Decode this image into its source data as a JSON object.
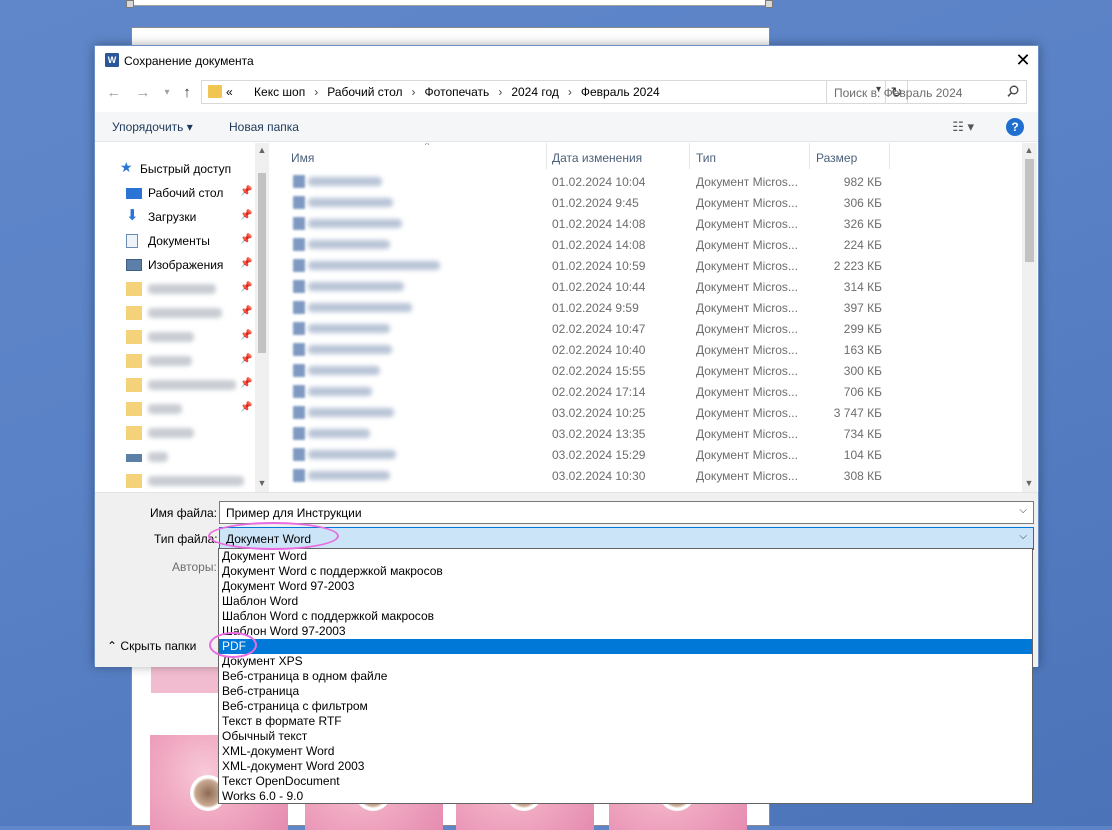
{
  "dialog": {
    "title": "Сохранение документа",
    "close_glyph": "✕",
    "path": [
      "«",
      "Кекс шоп",
      "Рабочий стол",
      "Фотопечать",
      "2024 год",
      "Февраль 2024"
    ],
    "search_placeholder": "Поиск в: Февраль 2024"
  },
  "toolbar": {
    "organize_label": "Упорядочить ▾",
    "new_folder_label": "Новая папка",
    "help_glyph": "?"
  },
  "navpane": {
    "items": [
      {
        "label": "Быстрый доступ",
        "icon": "star-icon"
      },
      {
        "label": "Рабочий стол",
        "icon": "desktop-icon"
      },
      {
        "label": "Загрузки",
        "icon": "download-icon"
      },
      {
        "label": "Документы",
        "icon": "documents-icon"
      },
      {
        "label": "Изображения",
        "icon": "pictures-icon"
      }
    ]
  },
  "columns": {
    "name": "Имя",
    "date": "Дата изменения",
    "type": "Тип",
    "size": "Размер"
  },
  "files": [
    {
      "date": "01.02.2024 10:04",
      "type": "Документ Micros...",
      "size": "982 КБ"
    },
    {
      "date": "01.02.2024 9:45",
      "type": "Документ Micros...",
      "size": "306 КБ"
    },
    {
      "date": "01.02.2024 14:08",
      "type": "Документ Micros...",
      "size": "326 КБ"
    },
    {
      "date": "01.02.2024 14:08",
      "type": "Документ Micros...",
      "size": "224 КБ"
    },
    {
      "date": "01.02.2024 10:59",
      "type": "Документ Micros...",
      "size": "2 223 КБ"
    },
    {
      "date": "01.02.2024 10:44",
      "type": "Документ Micros...",
      "size": "314 КБ"
    },
    {
      "date": "01.02.2024 9:59",
      "type": "Документ Micros...",
      "size": "397 КБ"
    },
    {
      "date": "02.02.2024 10:47",
      "type": "Документ Micros...",
      "size": "299 КБ"
    },
    {
      "date": "02.02.2024 10:40",
      "type": "Документ Micros...",
      "size": "163 КБ"
    },
    {
      "date": "02.02.2024 15:55",
      "type": "Документ Micros...",
      "size": "300 КБ"
    },
    {
      "date": "02.02.2024 17:14",
      "type": "Документ Micros...",
      "size": "706 КБ"
    },
    {
      "date": "03.02.2024 10:25",
      "type": "Документ Micros...",
      "size": "3 747 КБ"
    },
    {
      "date": "03.02.2024 13:35",
      "type": "Документ Micros...",
      "size": "734 КБ"
    },
    {
      "date": "03.02.2024 15:29",
      "type": "Документ Micros...",
      "size": "104 КБ"
    },
    {
      "date": "03.02.2024 10:30",
      "type": "Документ Micros...",
      "size": "308 КБ"
    }
  ],
  "form": {
    "filename_label": "Имя файла:",
    "filename_value": "Пример для Инструкции",
    "filetype_label": "Тип файла:",
    "filetype_value": "Документ Word",
    "authors_label": "Авторы:",
    "hide_folders_label": "Скрыть папки"
  },
  "filetype_options": [
    "Документ Word",
    "Документ Word с поддержкой макросов",
    "Документ Word 97-2003",
    "Шаблон Word",
    "Шаблон Word с поддержкой макросов",
    "Шаблон Word 97-2003",
    "PDF",
    "Документ XPS",
    "Веб-страница в одном файле",
    "Веб-страница",
    "Веб-страница с фильтром",
    "Текст в формате RTF",
    "Обычный текст",
    "XML-документ Word",
    "XML-документ Word 2003",
    "Текст OpenDocument",
    "Works 6.0 - 9.0"
  ],
  "selected_option": "PDF",
  "colors": {
    "accent": "#0078d7",
    "annotation": "#e86ce0",
    "desktop_bg": "#5a82c6"
  }
}
